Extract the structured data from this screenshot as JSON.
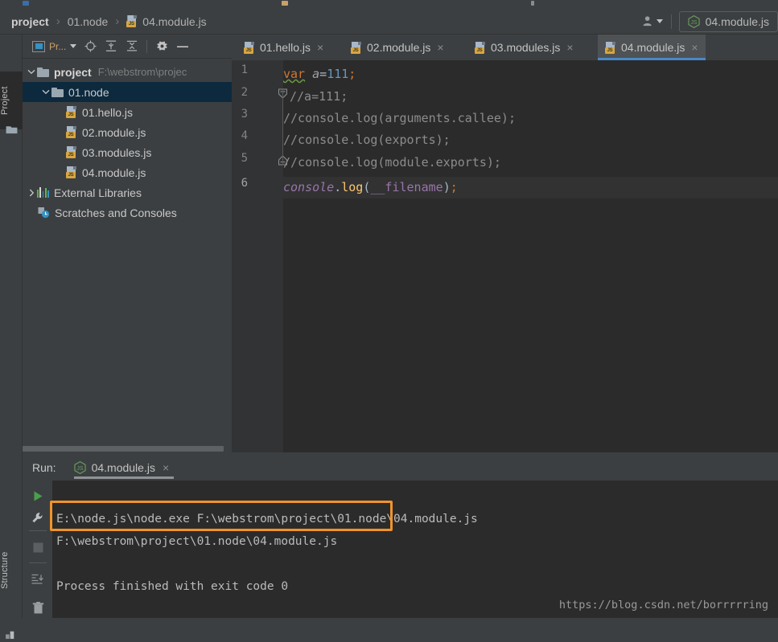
{
  "window": {
    "theme_bg": "#3c3f41",
    "editor_bg": "#2b2b2b",
    "accent": "#4a88c7",
    "highlight_box_color": "#f0932b"
  },
  "breadcrumb": {
    "items": [
      {
        "label": "project",
        "bold": true,
        "icon": null
      },
      {
        "label": "01.node",
        "bold": false,
        "icon": null
      },
      {
        "label": "04.module.js",
        "bold": false,
        "icon": "js-file-icon"
      }
    ],
    "separator": "›"
  },
  "titlebar_right": {
    "user_icon": "user-icon",
    "user_caret": "chevron-down-icon",
    "run_configuration": {
      "icon": "nodejs-icon",
      "label": "04.module.js"
    }
  },
  "left_tool_strips": {
    "top_tab": {
      "label": "Project",
      "icon": "folder-icon"
    },
    "bottom_tab": {
      "label": "Structure",
      "icon": "structure-icon"
    }
  },
  "project_panel": {
    "toolbar": {
      "view_selector_label": "Pr...",
      "view_selector_caret": "chevron-down-icon",
      "buttons": [
        {
          "name": "locate-icon",
          "title": "Select Opened File"
        },
        {
          "name": "expand-all-icon",
          "title": "Expand All"
        },
        {
          "name": "collapse-all-icon",
          "title": "Collapse All"
        },
        {
          "name": "settings-gear-icon",
          "title": "Settings"
        },
        {
          "name": "hide-icon",
          "title": "Hide"
        }
      ]
    },
    "tree": [
      {
        "label": "project",
        "path": "F:\\webstrom\\projec",
        "icon": "folder-icon",
        "arrow": "expanded",
        "indent": 0,
        "bold": true,
        "selected": false
      },
      {
        "label": "01.node",
        "path": "",
        "icon": "folder-icon",
        "arrow": "expanded",
        "indent": 1,
        "bold": false,
        "selected": true
      },
      {
        "label": "01.hello.js",
        "path": "",
        "icon": "js-file-icon",
        "arrow": "none",
        "indent": 2,
        "bold": false,
        "selected": false
      },
      {
        "label": "02.module.js",
        "path": "",
        "icon": "js-file-icon",
        "arrow": "none",
        "indent": 2,
        "bold": false,
        "selected": false
      },
      {
        "label": "03.modules.js",
        "path": "",
        "icon": "js-file-icon",
        "arrow": "none",
        "indent": 2,
        "bold": false,
        "selected": false
      },
      {
        "label": "04.module.js",
        "path": "",
        "icon": "js-file-icon",
        "arrow": "none",
        "indent": 2,
        "bold": false,
        "selected": false
      },
      {
        "label": "External Libraries",
        "path": "",
        "icon": "libraries-icon",
        "arrow": "collapsed",
        "indent": 0,
        "bold": false,
        "selected": false
      },
      {
        "label": "Scratches and Consoles",
        "path": "",
        "icon": "scratches-icon",
        "arrow": "none",
        "indent": 0,
        "bold": false,
        "selected": false
      }
    ]
  },
  "editor_tabs": [
    {
      "label": "01.hello.js",
      "icon": "js-file-icon",
      "active": false,
      "close": "×"
    },
    {
      "label": "02.module.js",
      "icon": "js-file-icon",
      "active": false,
      "close": "×"
    },
    {
      "label": "03.modules.js",
      "icon": "js-file-icon",
      "active": false,
      "close": "×"
    },
    {
      "label": "04.module.js",
      "icon": "js-file-icon",
      "active": true,
      "close": "×"
    }
  ],
  "editor": {
    "line_numbers": [
      "1",
      "2",
      "3",
      "4",
      "5",
      "6"
    ],
    "current_line": 6,
    "lines": [
      {
        "n": "1",
        "text": "var a=111;"
      },
      {
        "n": "2",
        "text": "//a=111;"
      },
      {
        "n": "3",
        "text": "//console.log(arguments.callee);"
      },
      {
        "n": "4",
        "text": "//console.log(exports);"
      },
      {
        "n": "5",
        "text": "//console.log(module.exports);"
      },
      {
        "n": "6",
        "text": "console.log(__filename);"
      }
    ],
    "fold_markers": [
      {
        "line": 2,
        "type": "fold-collapse-icon"
      },
      {
        "line": 5,
        "type": "fold-end-icon"
      }
    ]
  },
  "run_panel": {
    "label": "Run:",
    "tab": {
      "label": "04.module.js",
      "icon": "nodejs-icon",
      "close": "×"
    },
    "side_buttons": [
      {
        "name": "rerun-play-icon"
      },
      {
        "name": "wrench-settings-icon"
      },
      {
        "name": "stop-icon"
      },
      {
        "name": "scroll-to-end-icon"
      },
      {
        "name": "trash-icon"
      }
    ],
    "console_lines": [
      "E:\\node.js\\node.exe F:\\webstrom\\project\\01.node\\04.module.js",
      "F:\\webstrom\\project\\01.node\\04.module.js",
      "",
      "Process finished with exit code 0"
    ],
    "highlighted_line_index": 1
  },
  "watermark": "https://blog.csdn.net/borrrrring"
}
